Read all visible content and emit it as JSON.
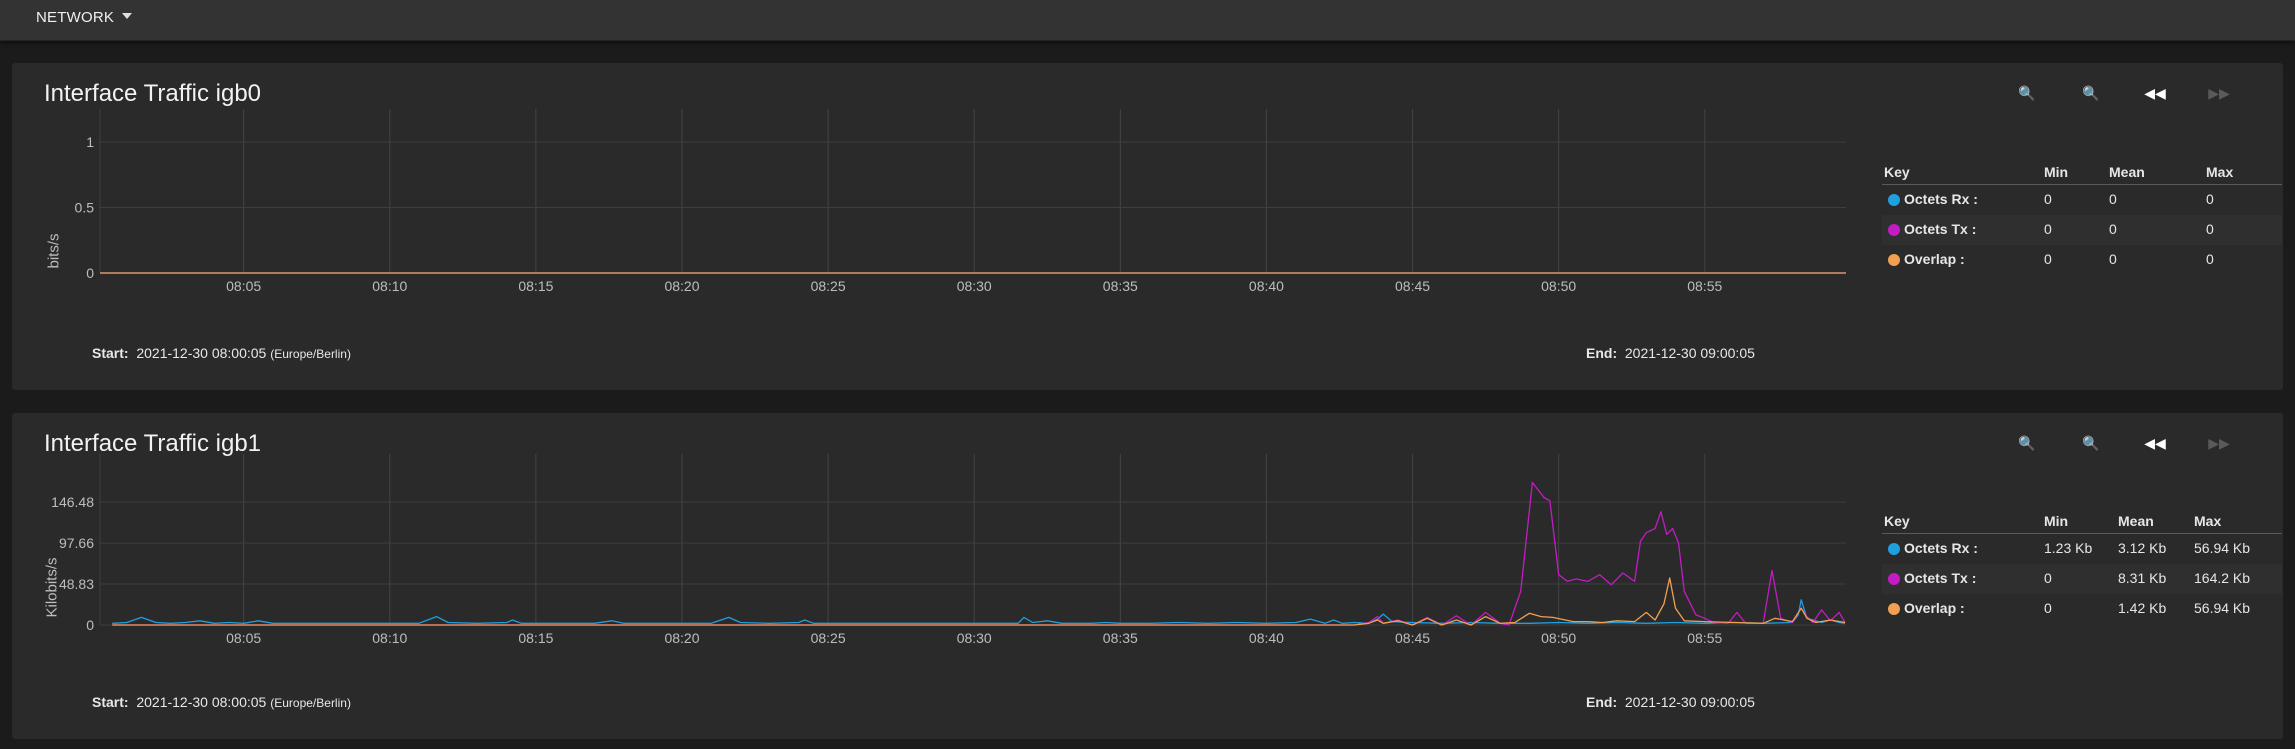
{
  "topbar": {
    "label": "NETWORK"
  },
  "colors": {
    "rx": "#1e9fe0",
    "tx": "#c21cc2",
    "overlap": "#f0a050"
  },
  "time_ticks": [
    "08:05",
    "08:10",
    "08:15",
    "08:20",
    "08:25",
    "08:30",
    "08:35",
    "08:40",
    "08:45",
    "08:50",
    "08:55"
  ],
  "panels": [
    {
      "title": "Interface Traffic igb0",
      "ylabel": "bits/s",
      "start_label": "Start:",
      "start_value": "2021-12-30 08:00:05",
      "timezone": "(Europe/Berlin)",
      "end_label": "End:",
      "end_value": "2021-12-30 09:00:05",
      "legend": {
        "headers": [
          "Key",
          "Min",
          "Mean",
          "Max"
        ],
        "rows": [
          {
            "name": "Octets Rx :",
            "min": "0",
            "mean": "0",
            "max": "0"
          },
          {
            "name": "Octets Tx :",
            "min": "0",
            "mean": "0",
            "max": "0"
          },
          {
            "name": "Overlap :",
            "min": "0",
            "mean": "0",
            "max": "0"
          }
        ]
      }
    },
    {
      "title": "Interface Traffic igb1",
      "ylabel": "Kilobits/s",
      "start_label": "Start:",
      "start_value": "2021-12-30 08:00:05",
      "timezone": "(Europe/Berlin)",
      "end_label": "End:",
      "end_value": "2021-12-30 09:00:05",
      "legend": {
        "headers": [
          "Key",
          "Min",
          "Mean",
          "Max"
        ],
        "rows": [
          {
            "name": "Octets Rx :",
            "min": "1.23 Kb",
            "mean": "3.12 Kb",
            "max": "56.94 Kb"
          },
          {
            "name": "Octets Tx :",
            "min": "0",
            "mean": "8.31 Kb",
            "max": "164.2 Kb"
          },
          {
            "name": "Overlap :",
            "min": "0",
            "mean": "1.42 Kb",
            "max": "56.94 Kb"
          }
        ]
      }
    }
  ],
  "chart_data": [
    {
      "type": "line",
      "title": "Interface Traffic igb0",
      "xlabel": "",
      "ylabel": "bits/s",
      "x": [
        "08:05",
        "08:10",
        "08:15",
        "08:20",
        "08:25",
        "08:30",
        "08:35",
        "08:40",
        "08:45",
        "08:50",
        "08:55"
      ],
      "yticks": [
        "0",
        "0.5",
        "1"
      ],
      "ylim": [
        0,
        1.1
      ],
      "series": [
        {
          "name": "Octets Rx",
          "color": "#1e9fe0",
          "values": [
            0,
            0,
            0,
            0,
            0,
            0,
            0,
            0,
            0,
            0,
            0
          ]
        },
        {
          "name": "Octets Tx",
          "color": "#c21cc2",
          "values": [
            0,
            0,
            0,
            0,
            0,
            0,
            0,
            0,
            0,
            0,
            0
          ]
        },
        {
          "name": "Overlap",
          "color": "#f0a050",
          "values": [
            0,
            0,
            0,
            0,
            0,
            0,
            0,
            0,
            0,
            0,
            0
          ]
        }
      ],
      "grid": true
    },
    {
      "type": "line",
      "title": "Interface Traffic igb1",
      "xlabel": "",
      "ylabel": "Kilobits/s",
      "x": [
        "08:05",
        "08:10",
        "08:15",
        "08:20",
        "08:25",
        "08:30",
        "08:35",
        "08:40",
        "08:45",
        "08:50",
        "08:55"
      ],
      "yticks": [
        "0",
        "48.83",
        "97.66",
        "146.48"
      ],
      "ylim": [
        0,
        180
      ],
      "minutes_start": 0.5,
      "minutes_end": 59.8,
      "series": [
        {
          "name": "Octets Rx",
          "color": "#1e9fe0",
          "points": [
            [
              0.5,
              2
            ],
            [
              1,
              3
            ],
            [
              1.5,
              9
            ],
            [
              2,
              3
            ],
            [
              2.5,
              2
            ],
            [
              3,
              3
            ],
            [
              3.5,
              5
            ],
            [
              4,
              2
            ],
            [
              4.5,
              3
            ],
            [
              5,
              2
            ],
            [
              5.5,
              5
            ],
            [
              6,
              2
            ],
            [
              8,
              2
            ],
            [
              10,
              2
            ],
            [
              11,
              2
            ],
            [
              11.6,
              10
            ],
            [
              12,
              3
            ],
            [
              13,
              2
            ],
            [
              14,
              3
            ],
            [
              14.2,
              6
            ],
            [
              14.5,
              2
            ],
            [
              17,
              2
            ],
            [
              17.6,
              5
            ],
            [
              18,
              2
            ],
            [
              21,
              2
            ],
            [
              21.6,
              9
            ],
            [
              22,
              3
            ],
            [
              23,
              2
            ],
            [
              24,
              3
            ],
            [
              24.2,
              6
            ],
            [
              24.5,
              2
            ],
            [
              26,
              2
            ],
            [
              28,
              2
            ],
            [
              30,
              2
            ],
            [
              31.5,
              2
            ],
            [
              31.7,
              9
            ],
            [
              32,
              3
            ],
            [
              32.5,
              5
            ],
            [
              33,
              2
            ],
            [
              34,
              2
            ],
            [
              34.5,
              3
            ],
            [
              35,
              2
            ],
            [
              36,
              2
            ],
            [
              37,
              3
            ],
            [
              38,
              2
            ],
            [
              39,
              3
            ],
            [
              40,
              2
            ],
            [
              41,
              3
            ],
            [
              41.5,
              7
            ],
            [
              42,
              2
            ],
            [
              42.3,
              6
            ],
            [
              42.6,
              2
            ],
            [
              43,
              3
            ],
            [
              43.5,
              2
            ],
            [
              43.8,
              7
            ],
            [
              44,
              13
            ],
            [
              44.3,
              4
            ],
            [
              45,
              3
            ],
            [
              46,
              2
            ],
            [
              47,
              3
            ],
            [
              48,
              2
            ],
            [
              49,
              2
            ],
            [
              50,
              3
            ],
            [
              51,
              2
            ],
            [
              52,
              3
            ],
            [
              53,
              2
            ],
            [
              54,
              3
            ],
            [
              55,
              2
            ],
            [
              56,
              3
            ],
            [
              57,
              2
            ],
            [
              58,
              3
            ],
            [
              58.2,
              12
            ],
            [
              58.3,
              30
            ],
            [
              58.5,
              8
            ],
            [
              59,
              3
            ],
            [
              59.3,
              6
            ],
            [
              59.6,
              3
            ],
            [
              59.8,
              2
            ]
          ]
        },
        {
          "name": "Octets Tx",
          "color": "#c21cc2",
          "points": [
            [
              0.5,
              0
            ],
            [
              43,
              0
            ],
            [
              43.5,
              3
            ],
            [
              43.8,
              10
            ],
            [
              44,
              2
            ],
            [
              44.5,
              6
            ],
            [
              45,
              0
            ],
            [
              45.5,
              9
            ],
            [
              46,
              0
            ],
            [
              46.5,
              11
            ],
            [
              47,
              0
            ],
            [
              47.5,
              15
            ],
            [
              48,
              2
            ],
            [
              48.3,
              0
            ],
            [
              48.7,
              40
            ],
            [
              49.1,
              170
            ],
            [
              49.5,
              152
            ],
            [
              49.7,
              148
            ],
            [
              50,
              60
            ],
            [
              50.3,
              52
            ],
            [
              50.6,
              55
            ],
            [
              51,
              52
            ],
            [
              51.4,
              60
            ],
            [
              51.8,
              48
            ],
            [
              52.2,
              62
            ],
            [
              52.6,
              52
            ],
            [
              52.8,
              100
            ],
            [
              53,
              110
            ],
            [
              53.3,
              115
            ],
            [
              53.5,
              135
            ],
            [
              53.7,
              108
            ],
            [
              53.9,
              115
            ],
            [
              54.1,
              98
            ],
            [
              54.3,
              40
            ],
            [
              54.7,
              12
            ],
            [
              55,
              8
            ],
            [
              55.3,
              3
            ],
            [
              55.8,
              2
            ],
            [
              56.1,
              15
            ],
            [
              56.4,
              2
            ],
            [
              57,
              2
            ],
            [
              57.3,
              65
            ],
            [
              57.6,
              8
            ],
            [
              58,
              3
            ],
            [
              58.3,
              20
            ],
            [
              58.5,
              10
            ],
            [
              58.7,
              3
            ],
            [
              59,
              18
            ],
            [
              59.3,
              5
            ],
            [
              59.6,
              15
            ],
            [
              59.8,
              3
            ]
          ]
        },
        {
          "name": "Overlap",
          "color": "#f0a050",
          "points": [
            [
              0.5,
              0
            ],
            [
              43,
              0
            ],
            [
              43.5,
              2
            ],
            [
              43.8,
              6
            ],
            [
              44,
              2
            ],
            [
              44.5,
              5
            ],
            [
              45,
              0
            ],
            [
              45.5,
              8
            ],
            [
              46,
              0
            ],
            [
              46.5,
              6
            ],
            [
              47,
              0
            ],
            [
              47.5,
              10
            ],
            [
              48,
              2
            ],
            [
              48.5,
              3
            ],
            [
              49,
              14
            ],
            [
              49.4,
              10
            ],
            [
              49.8,
              9
            ],
            [
              50.5,
              4
            ],
            [
              51,
              4
            ],
            [
              51.5,
              3
            ],
            [
              52,
              5
            ],
            [
              52.6,
              4
            ],
            [
              53,
              15
            ],
            [
              53.3,
              6
            ],
            [
              53.6,
              25
            ],
            [
              53.8,
              56
            ],
            [
              54,
              20
            ],
            [
              54.3,
              5
            ],
            [
              55,
              4
            ],
            [
              56,
              3
            ],
            [
              57,
              2
            ],
            [
              57.4,
              8
            ],
            [
              58,
              4
            ],
            [
              58.3,
              20
            ],
            [
              58.5,
              8
            ],
            [
              58.8,
              3
            ],
            [
              59.3,
              6
            ],
            [
              59.8,
              3
            ]
          ]
        }
      ],
      "grid": true
    }
  ]
}
